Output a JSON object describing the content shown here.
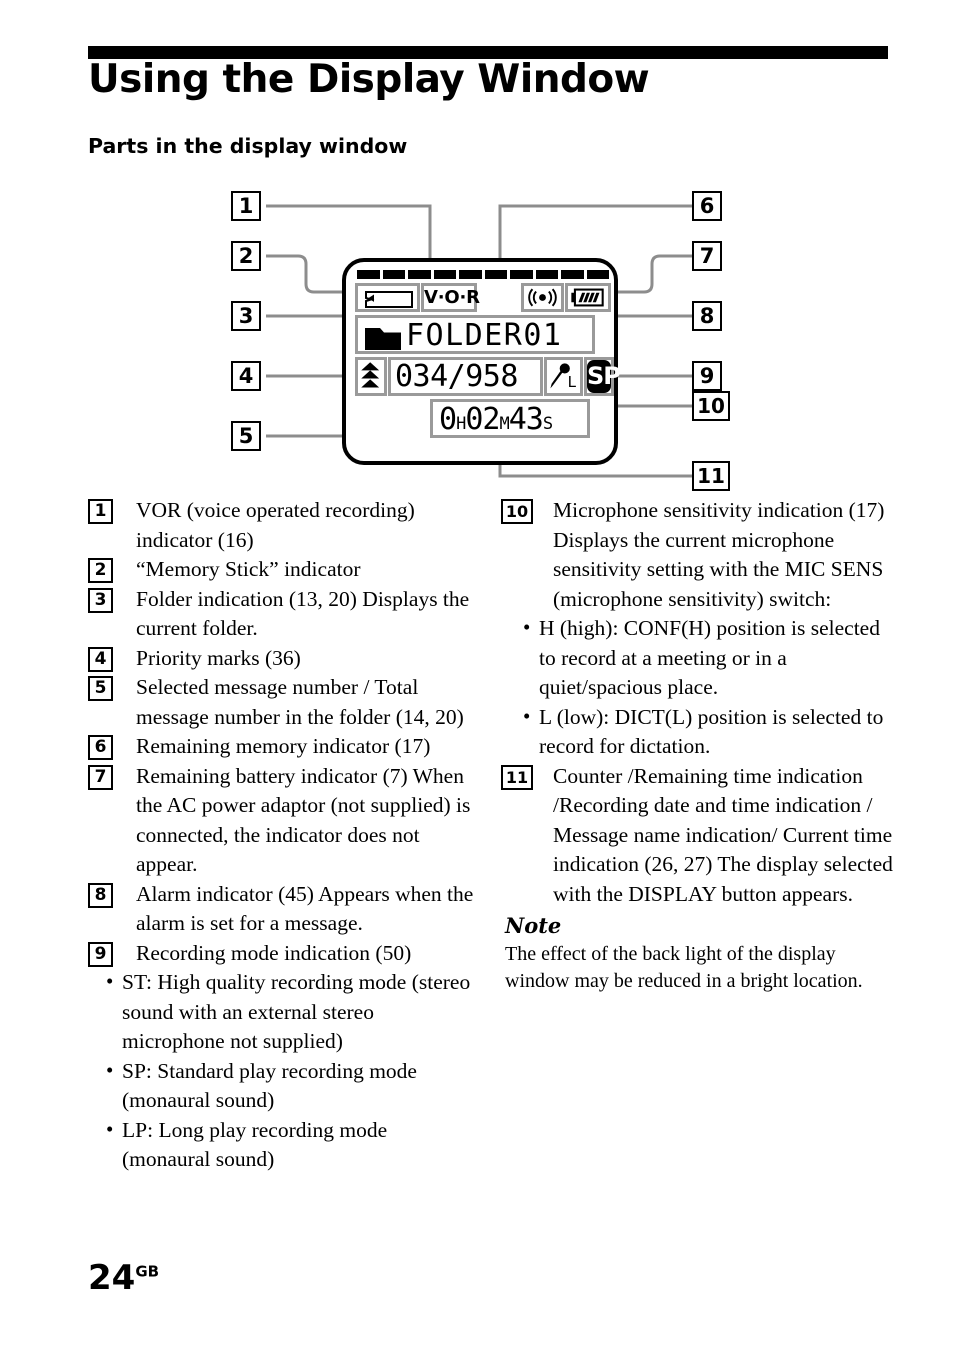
{
  "header": {
    "title": "Using the Display Window",
    "subtitle": "Parts in the display window"
  },
  "lcd": {
    "memory_bar_segments": 10,
    "memory_stick_icon": "memory-stick-icon",
    "vor_label": "V·O·R",
    "alarm_icon": "alarm-icon",
    "battery_icon": "battery-icon",
    "battery_bars": 4,
    "folder_icon": "folder-icon",
    "folder_label": "FOLDER01",
    "priority_marks_icon": "priority-marks-icon",
    "message_numbers": "034/958",
    "mic_icon": "microphone-icon",
    "mic_sensitivity": "L",
    "rec_mode": "SP",
    "counter": {
      "hours": "0",
      "hours_unit": "H",
      "minutes": "02",
      "minutes_unit": "M",
      "seconds": "43",
      "seconds_unit": "S"
    }
  },
  "callouts": [
    "1",
    "2",
    "3",
    "4",
    "5",
    "6",
    "7",
    "8",
    "9",
    "10",
    "11"
  ],
  "left_column": [
    {
      "num": "1",
      "text": "VOR (voice operated recording) indicator (16)"
    },
    {
      "num": "2",
      "text": "“Memory Stick” indicator"
    },
    {
      "num": "3",
      "text": "Folder indication (13, 20) Displays the current folder."
    },
    {
      "num": "4",
      "text": "Priority marks (36)"
    },
    {
      "num": "5",
      "text": "Selected message number / Total message number in the folder (14, 20)"
    },
    {
      "num": "6",
      "text": "Remaining memory indicator (17)"
    },
    {
      "num": "7",
      "text": "Remaining battery indicator  (7) When the AC power adaptor (not supplied) is connected, the indicator does not appear."
    },
    {
      "num": "8",
      "text": "Alarm indicator (45) Appears when the alarm is set for a message."
    },
    {
      "num": "9",
      "text": "Recording mode indication (50)"
    }
  ],
  "item9_bullets": [
    "ST: High quality recording mode (stereo sound with an external stereo microphone not supplied)",
    "SP: Standard play recording mode (monaural sound)",
    "LP: Long play recording mode (monaural sound)"
  ],
  "right_column": [
    {
      "num": "10",
      "text": "Microphone sensitivity indication (17) Displays the current microphone sensitivity setting with the MIC SENS (microphone sensitivity) switch:"
    },
    {
      "num": "11",
      "text": "Counter /Remaining time indication /Recording date and time indication / Message name indication/ Current time indication (26, 27) The display selected with the DISPLAY button appears."
    }
  ],
  "item10_bullets": [
    "H (high):  CONF(H) position is selected to record at a meeting or in a quiet/spacious place.",
    "L (low): DICT(L) position is selected to record for dictation."
  ],
  "note": {
    "heading": "Note",
    "body": "The effect of the back light of the display window may be reduced in a bright location."
  },
  "page": {
    "number": "24",
    "suffix": "GB"
  },
  "colors": {
    "ink": "#000000",
    "leader": "#8d8d8d",
    "lcd_frame": "#9a9a9a"
  }
}
